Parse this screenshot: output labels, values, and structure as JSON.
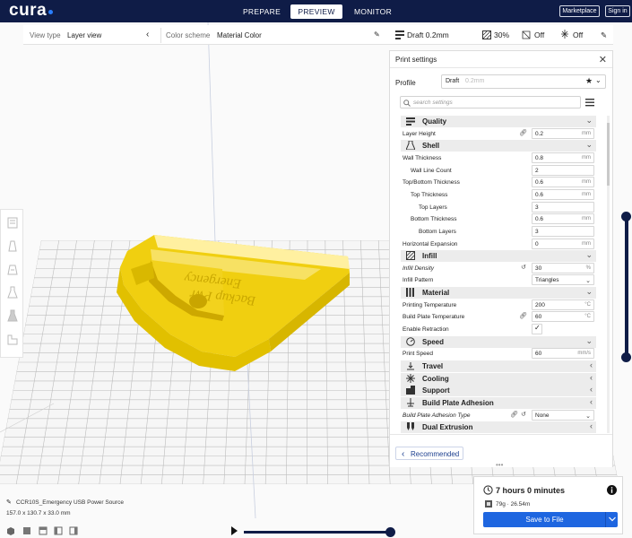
{
  "header": {
    "logo": "cura",
    "tabs": [
      {
        "label": "PREPARE",
        "active": false
      },
      {
        "label": "PREVIEW",
        "active": true
      },
      {
        "label": "MONITOR",
        "active": false
      }
    ],
    "marketplace_label": "Marketplace",
    "signin_label": "Sign in"
  },
  "viewbar": {
    "view_type_label": "View type",
    "view_type_value": "Layer view",
    "color_scheme_label": "Color scheme",
    "color_scheme_value": "Material Color"
  },
  "summary": {
    "profile": "Draft 0.2mm",
    "infill": "30%",
    "support": "Off",
    "adhesion": "Off"
  },
  "print_settings": {
    "title": "Print settings",
    "profile_label": "Profile",
    "profile_value": "Draft",
    "profile_sub": "0.2mm",
    "search_placeholder": "search settings",
    "rows": [
      {
        "type": "cat",
        "label": "Quality",
        "open": true
      },
      {
        "type": "set",
        "label": "Layer Height",
        "value": "0.2",
        "unit": "mm",
        "indent": 0,
        "link": true
      },
      {
        "type": "cat",
        "label": "Shell",
        "open": true
      },
      {
        "type": "set",
        "label": "Wall Thickness",
        "value": "0.8",
        "unit": "mm",
        "indent": 0
      },
      {
        "type": "set",
        "label": "Wall Line Count",
        "value": "2",
        "unit": "",
        "indent": 1
      },
      {
        "type": "set",
        "label": "Top/Bottom Thickness",
        "value": "0.6",
        "unit": "mm",
        "indent": 0
      },
      {
        "type": "set",
        "label": "Top Thickness",
        "value": "0.6",
        "unit": "mm",
        "indent": 1
      },
      {
        "type": "set",
        "label": "Top Layers",
        "value": "3",
        "unit": "",
        "indent": 2
      },
      {
        "type": "set",
        "label": "Bottom Thickness",
        "value": "0.6",
        "unit": "mm",
        "indent": 1
      },
      {
        "type": "set",
        "label": "Bottom Layers",
        "value": "3",
        "unit": "",
        "indent": 2
      },
      {
        "type": "set",
        "label": "Horizontal Expansion",
        "value": "0",
        "unit": "mm",
        "indent": 0
      },
      {
        "type": "cat",
        "label": "Infill",
        "open": true
      },
      {
        "type": "set",
        "label": "Infill Density",
        "value": "30",
        "unit": "%",
        "indent": 0,
        "italic": true,
        "reset": true
      },
      {
        "type": "set",
        "label": "Infill Pattern",
        "value": "Triangles",
        "unit": "",
        "indent": 0,
        "dropdown": true
      },
      {
        "type": "cat",
        "label": "Material",
        "open": true
      },
      {
        "type": "set",
        "label": "Printing Temperature",
        "value": "200",
        "unit": "°C",
        "indent": 0
      },
      {
        "type": "set",
        "label": "Build Plate Temperature",
        "value": "60",
        "unit": "°C",
        "indent": 0,
        "link": true
      },
      {
        "type": "check",
        "label": "Enable Retraction",
        "checked": true,
        "indent": 0
      },
      {
        "type": "cat",
        "label": "Speed",
        "open": true
      },
      {
        "type": "set",
        "label": "Print Speed",
        "value": "60",
        "unit": "mm/s",
        "indent": 0
      },
      {
        "type": "cat",
        "label": "Travel",
        "open": false
      },
      {
        "type": "cat",
        "label": "Cooling",
        "open": false
      },
      {
        "type": "cat",
        "label": "Support",
        "open": false
      },
      {
        "type": "cat",
        "label": "Build Plate Adhesion",
        "open": false
      },
      {
        "type": "set",
        "label": "Build Plate Adhesion Type",
        "value": "None",
        "unit": "",
        "indent": 0,
        "italic": true,
        "link": true,
        "reset": true,
        "dropdown": true
      },
      {
        "type": "cat",
        "label": "Dual Extrusion",
        "open": false
      }
    ],
    "recommended_label": "Recommended"
  },
  "model": {
    "name": "CCR10S_Emergency USB Power Source",
    "dimensions": "157.0 x 130.7 x 33.0 mm"
  },
  "output": {
    "time": "7 hours 0 minutes",
    "material": "79g · 26.54m",
    "save_label": "Save to File"
  },
  "colors": {
    "header_bg": "#0f1c47",
    "accent": "#1e66e0",
    "model_yellow": "#f5dc20"
  }
}
